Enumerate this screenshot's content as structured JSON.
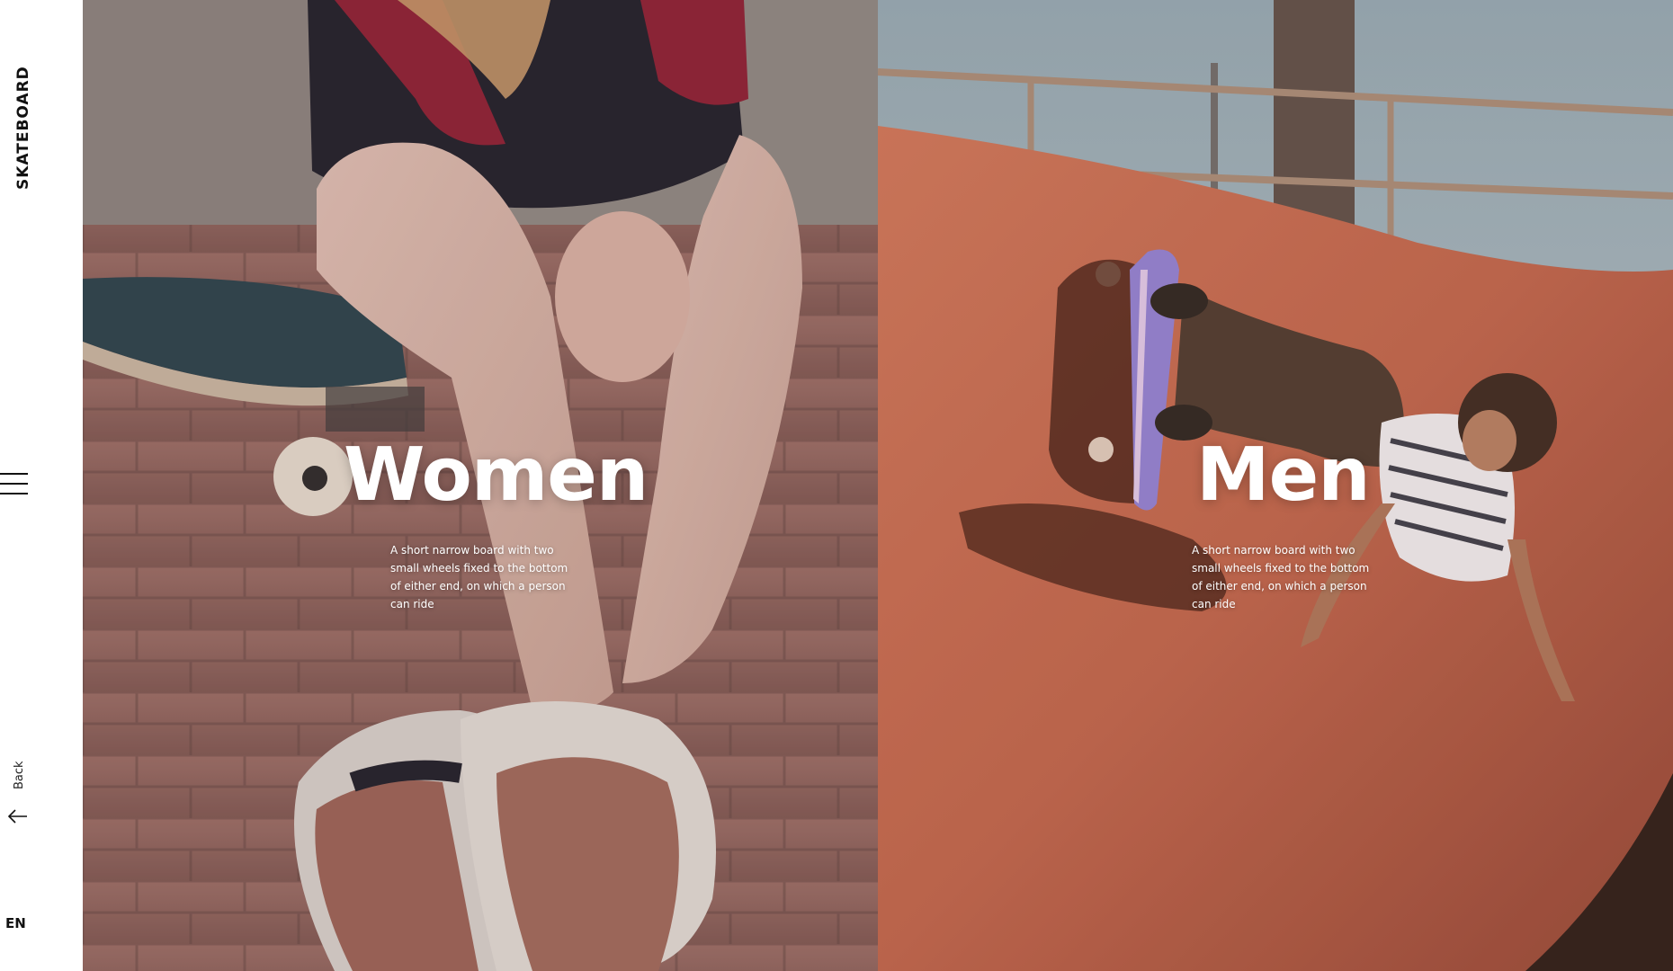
{
  "brand": {
    "name": "SKATEBOARD"
  },
  "sidebar": {
    "menu_icon": "hamburger-menu-icon",
    "back_label": "Back",
    "back_icon": "arrow-left-icon",
    "language": "EN"
  },
  "panels": [
    {
      "title": "Women",
      "description": "A short narrow board with two small wheels fixed to the bottom of either end, on which a person can ride"
    },
    {
      "title": "Men",
      "description": "A short narrow board with two small wheels fixed to the bottom of either end, on which a person can ride"
    }
  ],
  "colors": {
    "sidebar_bg": "#ffffff",
    "text_dark": "#111111",
    "overlay_text": "#ffffff",
    "women_tone": "#a36a63",
    "men_tone": "#b8614a",
    "sky": "#9fb3bf"
  }
}
